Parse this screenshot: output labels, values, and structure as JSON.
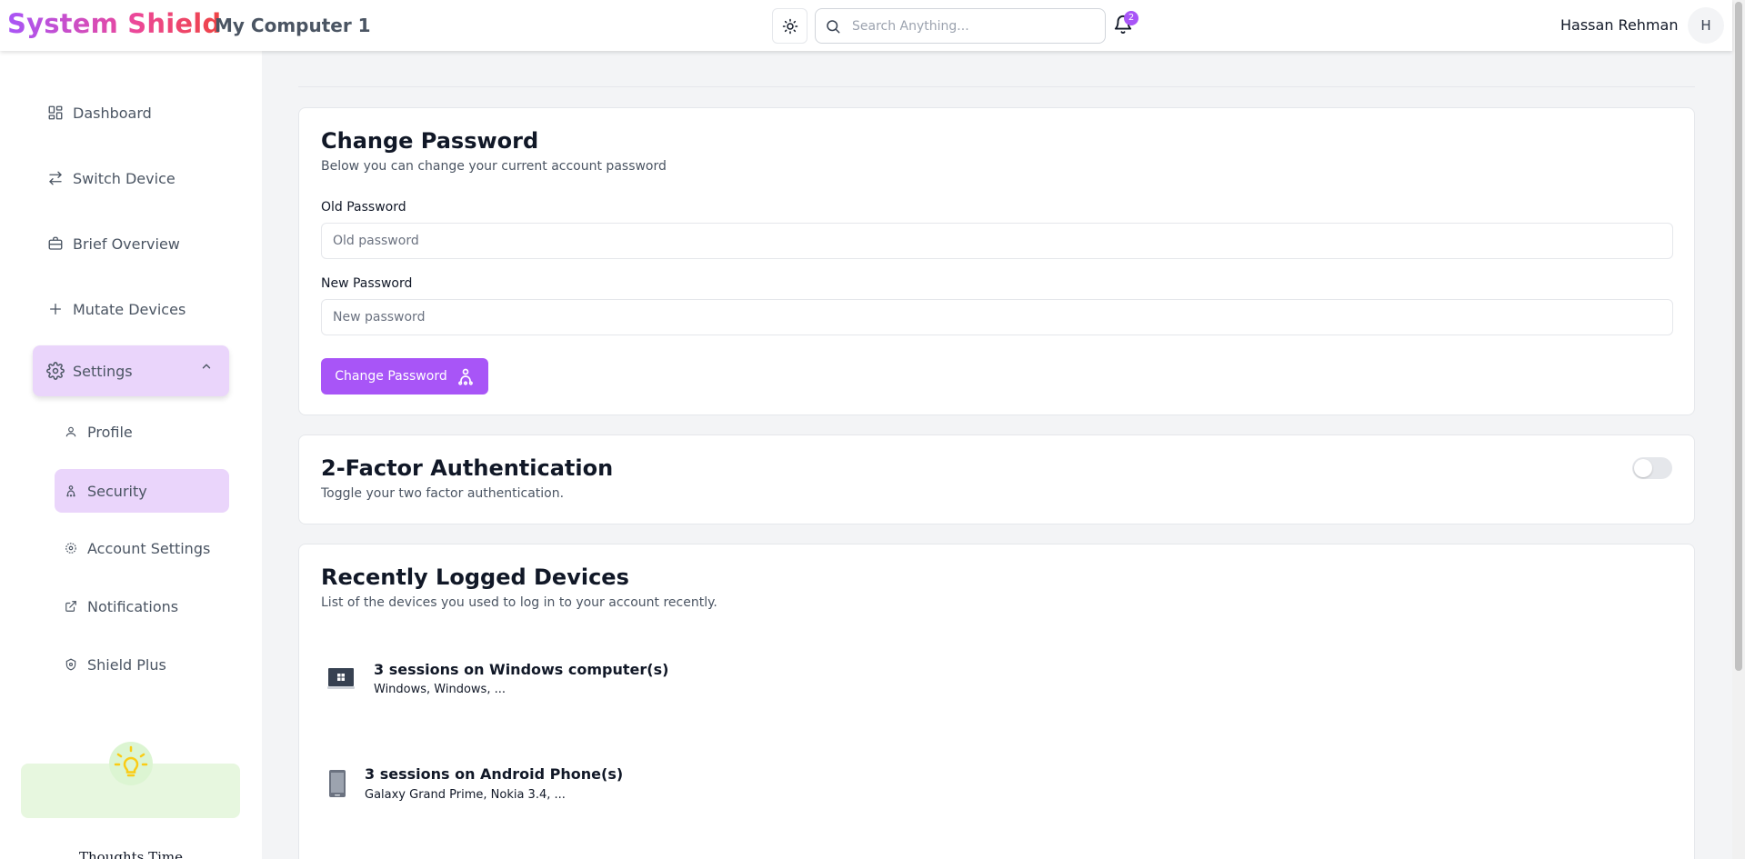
{
  "header": {
    "brand": "System Shield",
    "device_name": "My Computer 1",
    "search_placeholder": "Search Anything...",
    "notification_count": "2",
    "user_name": "Hassan Rehman",
    "avatar_initial": "H"
  },
  "sidebar": {
    "items": [
      {
        "label": "Dashboard",
        "icon": "dashboard-icon"
      },
      {
        "label": "Switch Device",
        "icon": "switch-arrows-icon"
      },
      {
        "label": "Brief Overview",
        "icon": "briefcase-icon"
      },
      {
        "label": "Mutate Devices",
        "icon": "plus-icon"
      },
      {
        "label": "Settings",
        "icon": "gear-icon"
      }
    ],
    "sub_items": [
      {
        "label": "Profile",
        "icon": "user-icon"
      },
      {
        "label": "Security",
        "icon": "security-icon"
      },
      {
        "label": "Account Settings",
        "icon": "gear-icon"
      },
      {
        "label": "Notifications",
        "icon": "external-link-icon"
      },
      {
        "label": "Shield Plus",
        "icon": "shield-icon"
      }
    ],
    "thoughts_title": "Thoughts Time"
  },
  "change_password": {
    "title": "Change Password",
    "subtitle": "Below you can change your current account password",
    "old_label": "Old Password",
    "old_placeholder": "Old password",
    "new_label": "New Password",
    "new_placeholder": "New password",
    "button_label": "Change Password"
  },
  "two_factor": {
    "title": "2-Factor Authentication",
    "subtitle": "Toggle your two factor authentication.",
    "enabled": false
  },
  "recent_devices": {
    "title": "Recently Logged Devices",
    "subtitle": "List of the devices you used to log in to your account recently.",
    "sessions": [
      {
        "title": "3 sessions on Windows computer(s)",
        "devices": "Windows, Windows, ...",
        "icon": "windows-laptop-icon"
      },
      {
        "title": "3 sessions on Android Phone(s)",
        "devices": "Galaxy Grand Prime, Nokia 3.4, ...",
        "icon": "android-phone-icon"
      }
    ]
  },
  "colors": {
    "accent": "#a855f7",
    "active_bg": "#ead5fb",
    "brand_gradient_start": "#a855f7",
    "brand_gradient_end": "#ef4444"
  }
}
